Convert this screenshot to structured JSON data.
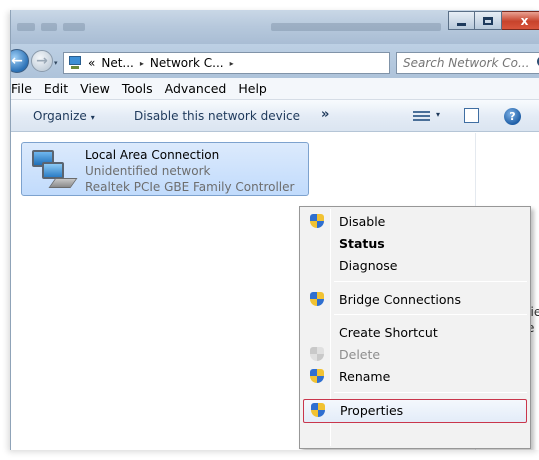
{
  "window": {
    "title_bar": {
      "caption_close": "x"
    },
    "address_bar": {
      "overflow": "«",
      "crumbs": [
        "Net...",
        "Network C..."
      ],
      "separator": "▸",
      "dropdown": "▾",
      "refresh": "↻"
    },
    "search": {
      "placeholder": "Search Network Co..."
    },
    "menu": [
      "File",
      "Edit",
      "View",
      "Tools",
      "Advanced",
      "Help"
    ],
    "commands": {
      "organize": "Organize",
      "organize_dd": "▾",
      "disable_device": "Disable this network device",
      "more": "»",
      "view_dd": "▾",
      "help": "?"
    },
    "adapter": {
      "name": "Local Area Connection",
      "status": "Unidentified network",
      "device": "Realtek PCIe GBE Family Controller"
    },
    "details_pane": {
      "line1": "evie",
      "line2": "ble"
    },
    "context_menu": {
      "items": [
        {
          "label": "Disable",
          "icon": "uac-shield-icon"
        },
        {
          "label": "Status",
          "bold": true
        },
        {
          "label": "Diagnose"
        },
        {
          "label": "Bridge Connections",
          "icon": "uac-shield-icon"
        },
        {
          "label": "Create Shortcut"
        },
        {
          "label": "Delete",
          "icon": "uac-shield-icon",
          "disabled": true
        },
        {
          "label": "Rename",
          "icon": "uac-shield-icon"
        },
        {
          "label": "Properties",
          "icon": "uac-shield-icon",
          "selected": true
        }
      ]
    }
  },
  "colors": {
    "selection_border": "#c9364c",
    "item_highlight": "#c1dbfc",
    "menu_background": "#f2f2f2"
  }
}
